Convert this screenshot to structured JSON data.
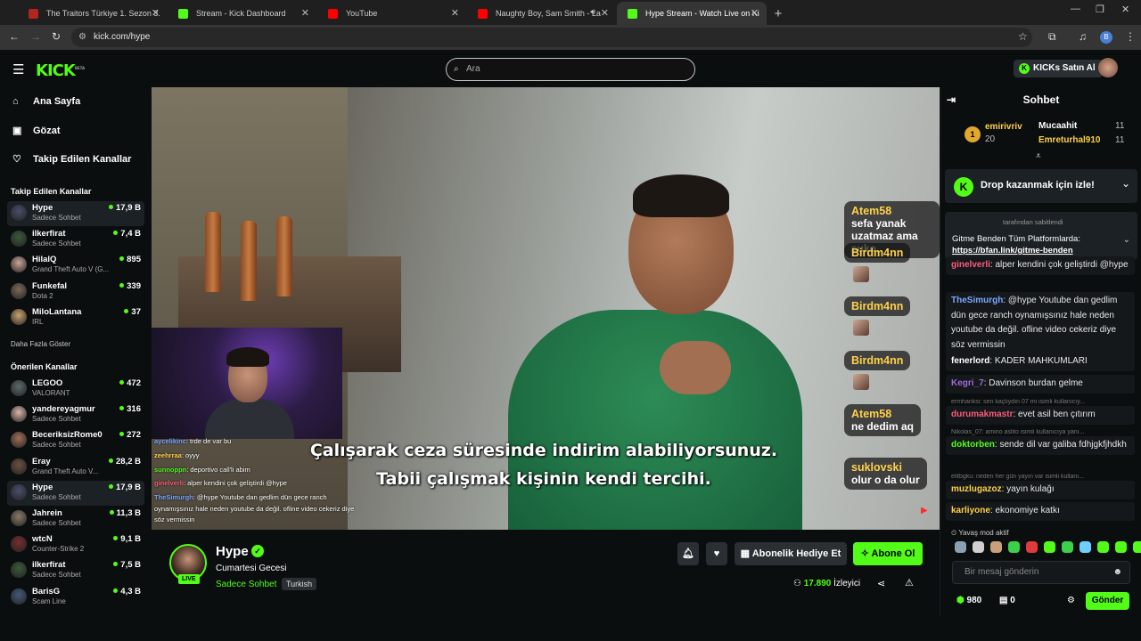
{
  "browser": {
    "tabs": [
      {
        "title": "The Traitors Türkiye 1. Sezon 3.",
        "color": "#b3261e"
      },
      {
        "title": "Stream - Kick Dashboard",
        "color": "#53fc18"
      },
      {
        "title": "YouTube",
        "color": "#ff0000"
      },
      {
        "title": "Naughty Boy, Sam Smith - La",
        "color": "#ff0000"
      },
      {
        "title": "Hype Stream - Watch Live on Ki",
        "color": "#53fc18"
      }
    ],
    "url": "kick.com/hype",
    "profile_letter": "B"
  },
  "header": {
    "logo": "KICK",
    "logo_badge": "BETA",
    "search_placeholder": "Ara",
    "buy_label": "KICKs Satın Al"
  },
  "sidebar": {
    "nav": [
      {
        "label": "Ana Sayfa",
        "icon": "home-icon"
      },
      {
        "label": "Gözat",
        "icon": "browse-icon"
      },
      {
        "label": "Takip Edilen Kanallar",
        "icon": "heart-icon"
      }
    ],
    "followed_title": "Takip Edilen Kanallar",
    "followed": [
      {
        "name": "Hype",
        "category": "Sadece Sohbet",
        "viewers": "17,9 B",
        "color": "#4b4f6b"
      },
      {
        "name": "ilkerfirat",
        "category": "Sadece Sohbet",
        "viewers": "7,4 B",
        "color": "#3b5a3a"
      },
      {
        "name": "HilalQ",
        "category": "Grand Theft Auto V (G...",
        "viewers": "895",
        "color": "#c9a59a"
      },
      {
        "name": "Funkefal",
        "category": "Dota 2",
        "viewers": "339",
        "color": "#7a6a5a"
      },
      {
        "name": "MiloLantana",
        "category": "IRL",
        "viewers": "37",
        "color": "#caa36d"
      }
    ],
    "more_label": "Daha Fazla Göster",
    "recommended_title": "Önerilen Kanallar",
    "recommended": [
      {
        "name": "LEGOO",
        "category": "VALORANT",
        "viewers": "472",
        "color": "#5b6b6a"
      },
      {
        "name": "yandereyagmur",
        "category": "Sadece Sohbet",
        "viewers": "316",
        "color": "#d8b6a8"
      },
      {
        "name": "BeceriksizRome0",
        "category": "Sadece Sohbet",
        "viewers": "272",
        "color": "#a06f55"
      },
      {
        "name": "Eray",
        "category": "Grand Theft Auto V...",
        "viewers": "28,2 B",
        "color": "#6b5140"
      },
      {
        "name": "Hype",
        "category": "Sadece Sohbet",
        "viewers": "17,9 B",
        "color": "#4b4f6b"
      },
      {
        "name": "Jahrein",
        "category": "Sadece Sohbet",
        "viewers": "11,3 B",
        "color": "#8b7b66"
      },
      {
        "name": "wtcN",
        "category": "Counter-Strike 2",
        "viewers": "9,1 B",
        "color": "#7a2d2d"
      },
      {
        "name": "ilkerfirat",
        "category": "Sadece Sohbet",
        "viewers": "7,5 B",
        "color": "#3b5a3a"
      },
      {
        "name": "BarisG",
        "category": "Scam Line",
        "viewers": "4,3 B",
        "color": "#445a7a"
      }
    ]
  },
  "video": {
    "subtitle_line1": "Çalışarak ceza süresinde indirim alabiliyorsunuz.",
    "subtitle_line2": "Tabii çalışmak kişinin kendi tercihi.",
    "overlay_chat": [
      {
        "user": "aycelikinc",
        "text": ": trde de var bu",
        "color": "#7aa7ff"
      },
      {
        "user": "zeehrraa",
        "text": ": oyyy",
        "color": "#ffd14a"
      },
      {
        "user": "sunnoppn",
        "text": ": deportivo call'li abim",
        "color": "#53fc18"
      },
      {
        "user": "ginelverli",
        "text": ": alper kendini çok geliştirdi @hype",
        "color": "#ff5a7a"
      },
      {
        "user": "TheSimurgh",
        "text": ": @hype Youtube dan gedlim dün gece ranch oynamışsınız hale neden youtube da değil. ofline video cekeriz diye söz vermissin",
        "color": "#7aa7ff"
      }
    ],
    "bubbles": [
      {
        "name": "Atem58",
        "msg": "sefa yanak uzatmaz ama suko"
      },
      {
        "name": "Birdm4nn",
        "msg": ""
      },
      {
        "name": "Birdm4nn",
        "msg": ""
      },
      {
        "name": "Birdm4nn",
        "msg": ""
      },
      {
        "name": "Atem58",
        "msg": "ne dedim aq"
      },
      {
        "name": "suklovski",
        "msg": "olur o da olur"
      }
    ]
  },
  "stream_info": {
    "name": "Hype",
    "title": "Cumartesi Gecesi",
    "category": "Sadece Sohbet",
    "language": "Turkish",
    "live_label": "LIVE",
    "gift_label": "Abonelik Hediye Et",
    "subscribe_label": "Abone Ol",
    "viewers": "17.890",
    "viewers_label": "İzleyici"
  },
  "chat": {
    "title": "Sohbet",
    "leaderboard": [
      {
        "rank": "1",
        "name": "emirivriv",
        "count": "20"
      },
      {
        "name": "Mucaahit",
        "count": "11"
      },
      {
        "name": "Emreturhal910",
        "count": "11"
      }
    ],
    "drop_label": "Drop kazanmak için izle!",
    "pinned_by": "tarafından sabitlendi",
    "pinned_text": "Gitme Benden Tüm Platformlarda:",
    "pinned_link": "https://bfan.link/gitme-benden",
    "messages": [
      {
        "user": "ginelverli",
        "text": ": alper kendini çok geliştirdi @hype",
        "color": "#ff5a7a"
      },
      {
        "user": "TheSimurgh",
        "text": ": @hype Youtube dan gedlim dün gece ranch oynamışsınız hale neden youtube da değil. ofline video cekeriz diye söz vermissin",
        "color": "#7aa7ff"
      },
      {
        "user": "fenerlord",
        "text": ": KADER MAHKUMLARI",
        "color": "#ffffff"
      },
      {
        "user": "Kegri_7",
        "text": ": Davinson burdan gelme",
        "color": "#a06ad8"
      },
      {
        "user": "durumakmastr",
        "text": ": evet asil ben çıtırım",
        "color": "#ff5a7a"
      },
      {
        "user": "doktorben",
        "text": ": sende dil var galiba fdhjgkfjhdkh",
        "color": "#53fc18"
      },
      {
        "user": "muzlugazoz",
        "text": ": yayın kulağı",
        "color": "#ffd14a"
      },
      {
        "user": "karliyone",
        "text": ": ekonomiye katkı",
        "color": "#ffd14a"
      }
    ],
    "system_notes": [
      "ermhanksi: sen kaçlıydın 07 mi isimli kullanıcıy...",
      "Nikolas_07: amino aslito isimli kullanıcıya yanı...",
      "elitbgku: neden her gün yayın var isimli kullanı..."
    ],
    "slow_mode": "Yavaş mod aktif",
    "input_placeholder": "Bir mesaj gönderin",
    "kicks_count": "980",
    "gift_count": "0",
    "send_label": "Gönder"
  }
}
